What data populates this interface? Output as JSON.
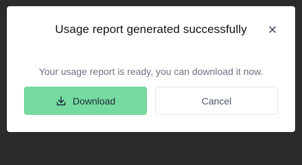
{
  "dialog": {
    "title": "Usage report generated successfully",
    "close_icon": "close-icon",
    "message": "Your usage report is ready, you can download it now.",
    "download_button": {
      "label": "Download",
      "icon": "download-icon"
    },
    "cancel_button": {
      "label": "Cancel"
    }
  },
  "colors": {
    "backdrop": "#2b2b2b",
    "dialog_bg": "#ffffff",
    "primary_button": "#75dba0",
    "message_text": "#6b7280"
  }
}
